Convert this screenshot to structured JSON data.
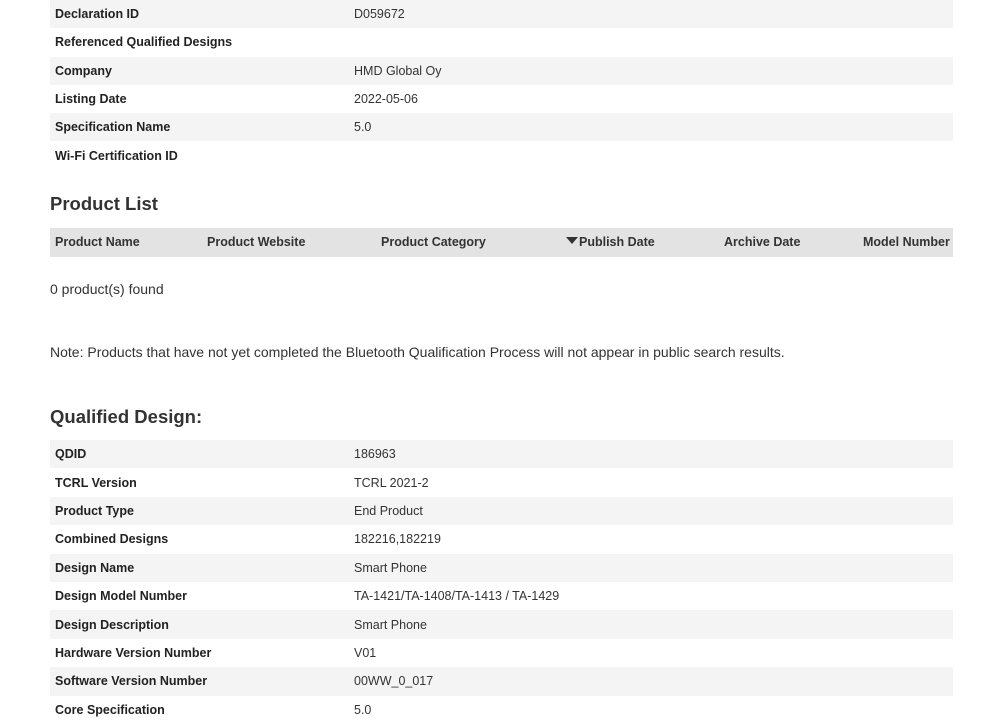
{
  "declaration": {
    "rows": [
      {
        "label": "Declaration ID",
        "value": "D059672"
      },
      {
        "label": "Referenced Qualified Designs",
        "value": ""
      },
      {
        "label": "Company",
        "value": "HMD Global Oy"
      },
      {
        "label": "Listing Date",
        "value": "2022-05-06"
      },
      {
        "label": "Specification Name",
        "value": "5.0"
      },
      {
        "label": "Wi-Fi Certification ID",
        "value": ""
      }
    ]
  },
  "product_list": {
    "title": "Product List",
    "columns": [
      "Product Name",
      "Product Website",
      "Product Category",
      "Publish Date",
      "Archive Date",
      "Model Number"
    ],
    "sorted_column": "Publish Date",
    "count_text": "0 product(s) found",
    "note": "Note: Products that have not yet completed the Bluetooth Qualification Process will not appear in public search results."
  },
  "qualified_design": {
    "title": "Qualified Design:",
    "rows": [
      {
        "label": "QDID",
        "value": "186963"
      },
      {
        "label": "TCRL Version",
        "value": "TCRL 2021-2"
      },
      {
        "label": "Product Type",
        "value": "End Product"
      },
      {
        "label": "Combined Designs",
        "value": "182216,182219"
      },
      {
        "label": "Design Name",
        "value": "Smart Phone"
      },
      {
        "label": "Design Model Number",
        "value": "TA-1421/TA-1408/TA-1413 / TA-1429"
      },
      {
        "label": "Design Description",
        "value": "Smart Phone"
      },
      {
        "label": "Hardware Version Number",
        "value": "V01"
      },
      {
        "label": "Software Version Number",
        "value": "00WW_0_017"
      },
      {
        "label": "Core Specification",
        "value": "5.0"
      }
    ]
  }
}
